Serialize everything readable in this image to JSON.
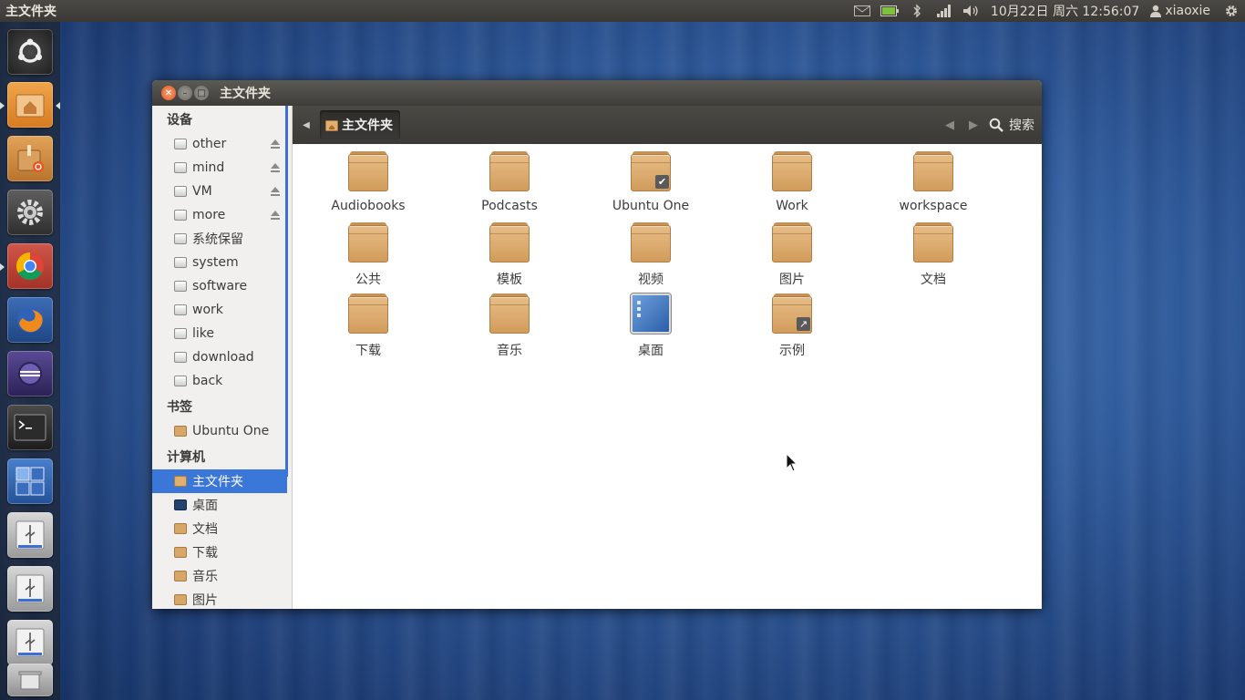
{
  "panel": {
    "app_title": "主文件夹",
    "clock": "10月22日 周六 12:56:07",
    "user": "xiaoxie",
    "icons": [
      "mail-icon",
      "battery-icon",
      "bluetooth-icon",
      "network-signal-icon",
      "volume-icon",
      "gear-icon"
    ]
  },
  "launcher": {
    "items": [
      {
        "name": "dash-home",
        "icon": "ubuntu-logo-icon"
      },
      {
        "name": "home-folder",
        "icon": "home-folder-icon"
      },
      {
        "name": "software-center",
        "icon": "software-center-icon"
      },
      {
        "name": "system-settings",
        "icon": "settings-gear-icon"
      },
      {
        "name": "chrome",
        "icon": "chrome-icon"
      },
      {
        "name": "firefox",
        "icon": "firefox-icon"
      },
      {
        "name": "eclipse",
        "icon": "eclipse-icon"
      },
      {
        "name": "terminal",
        "icon": "terminal-icon"
      },
      {
        "name": "workspace-switcher",
        "icon": "workspace-switcher-icon"
      },
      {
        "name": "usb-drive-1",
        "icon": "usb-drive-icon"
      },
      {
        "name": "usb-drive-2",
        "icon": "usb-drive-icon"
      },
      {
        "name": "usb-drive-3",
        "icon": "usb-drive-icon"
      },
      {
        "name": "trash",
        "icon": "trash-icon"
      }
    ]
  },
  "window": {
    "title": "主文件夹",
    "breadcrumb": "主文件夹",
    "search_label": "搜索"
  },
  "sidebar": {
    "devices_header": "设备",
    "devices": [
      {
        "label": "other",
        "ejectable": true
      },
      {
        "label": "mind",
        "ejectable": true
      },
      {
        "label": "VM",
        "ejectable": true
      },
      {
        "label": "more",
        "ejectable": true
      },
      {
        "label": "系统保留",
        "ejectable": false
      },
      {
        "label": "system",
        "ejectable": false
      },
      {
        "label": "software",
        "ejectable": false
      },
      {
        "label": "work",
        "ejectable": false
      },
      {
        "label": "like",
        "ejectable": false
      },
      {
        "label": "download",
        "ejectable": false
      },
      {
        "label": "back",
        "ejectable": false
      }
    ],
    "bookmarks_header": "书签",
    "bookmarks": [
      {
        "label": "Ubuntu One"
      }
    ],
    "computer_header": "计算机",
    "computer": [
      {
        "label": "主文件夹",
        "icon": "home",
        "selected": true
      },
      {
        "label": "桌面",
        "icon": "desktop"
      },
      {
        "label": "文档",
        "icon": "folder"
      },
      {
        "label": "下载",
        "icon": "folder"
      },
      {
        "label": "音乐",
        "icon": "folder"
      },
      {
        "label": "图片",
        "icon": "folder"
      }
    ]
  },
  "files": [
    {
      "label": "Audiobooks",
      "type": "folder"
    },
    {
      "label": "Podcasts",
      "type": "folder"
    },
    {
      "label": "Ubuntu One",
      "type": "folder",
      "emblem": "✔"
    },
    {
      "label": "Work",
      "type": "folder"
    },
    {
      "label": "workspace",
      "type": "folder"
    },
    {
      "label": "公共",
      "type": "folder"
    },
    {
      "label": "模板",
      "type": "folder"
    },
    {
      "label": "视频",
      "type": "folder"
    },
    {
      "label": "图片",
      "type": "folder"
    },
    {
      "label": "文档",
      "type": "folder"
    },
    {
      "label": "下载",
      "type": "folder"
    },
    {
      "label": "音乐",
      "type": "folder"
    },
    {
      "label": "桌面",
      "type": "desktop"
    },
    {
      "label": "示例",
      "type": "folder",
      "emblem": "↗"
    }
  ]
}
